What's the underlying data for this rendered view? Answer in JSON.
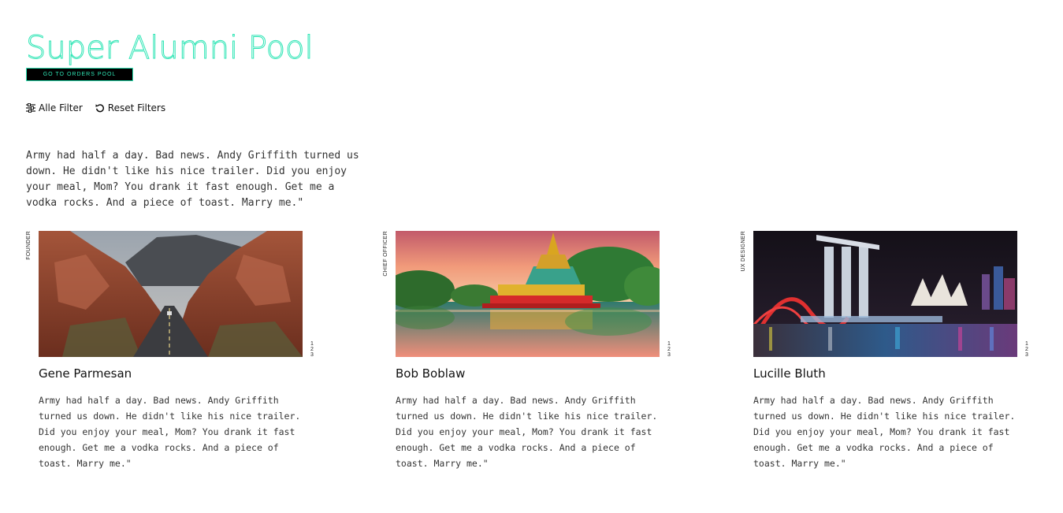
{
  "page": {
    "title": "Super Alumni Pool",
    "orders_button": "GO TO ORDERS POOL"
  },
  "filters": {
    "all_filters_label": "Alle Filter",
    "reset_label": "Reset Filters"
  },
  "intro": "Army had half a day. Bad news. Andy Griffith turned us down. He didn't like his nice trailer. Did you enjoy your meal, Mom? You drank it fast enough. Get me a vodka rocks. And a piece of toast. Marry me.\"",
  "cards": [
    {
      "role": "FOUNDER",
      "name": "Gene Parmesan",
      "bio": "Army had half a day. Bad news. Andy Griffith turned us down. He didn't like his nice trailer. Did you enjoy your meal, Mom? You drank it fast enough. Get me a vodka rocks. And a piece of toast. Marry me.\"",
      "pager": [
        "1",
        "2",
        "3"
      ],
      "image": "desert-road"
    },
    {
      "role": "CHIEF OFFICER",
      "name": "Bob Boblaw",
      "bio": "Army had half a day. Bad news. Andy Griffith turned us down. He didn't like his nice trailer. Did you enjoy your meal, Mom? You drank it fast enough. Get me a vodka rocks. And a piece of toast. Marry me.\"",
      "pager": [
        "1",
        "2",
        "3"
      ],
      "image": "pagoda-lake"
    },
    {
      "role": "UX DESIGNER",
      "name": "Lucille Bluth",
      "bio": "Army had half a day. Bad news. Andy Griffith turned us down. He didn't like his nice trailer. Did you enjoy your meal, Mom? You drank it fast enough. Get me a vodka rocks. And a piece of toast. Marry me.\"",
      "pager": [
        "1",
        "2",
        "3"
      ],
      "image": "city-night"
    }
  ],
  "colors": {
    "accent": "#2fe5b5",
    "button_bg": "#000000",
    "text": "#222222"
  },
  "icons": {
    "all_filters": "sliders-icon",
    "reset": "reset-icon"
  }
}
